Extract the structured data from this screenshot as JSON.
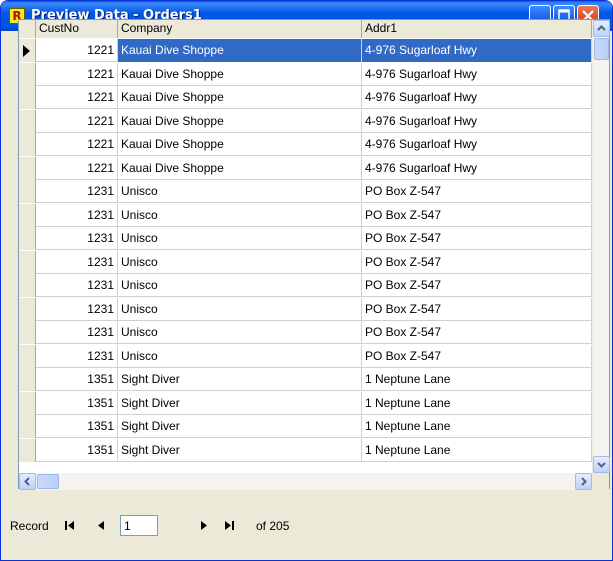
{
  "window": {
    "title": "Preview Data - Orders1",
    "app_icon_letter": "R",
    "accent": "#0055E5",
    "selection_color": "#316AC5"
  },
  "grid": {
    "columns": [
      "CustNo",
      "Company",
      "Addr1"
    ],
    "rows": [
      {
        "custno": "1221",
        "company": "Kauai Dive Shoppe",
        "addr1": "4-976 Sugarloaf Hwy",
        "selected": true
      },
      {
        "custno": "1221",
        "company": "Kauai Dive Shoppe",
        "addr1": "4-976 Sugarloaf Hwy"
      },
      {
        "custno": "1221",
        "company": "Kauai Dive Shoppe",
        "addr1": "4-976 Sugarloaf Hwy"
      },
      {
        "custno": "1221",
        "company": "Kauai Dive Shoppe",
        "addr1": "4-976 Sugarloaf Hwy"
      },
      {
        "custno": "1221",
        "company": "Kauai Dive Shoppe",
        "addr1": "4-976 Sugarloaf Hwy"
      },
      {
        "custno": "1221",
        "company": "Kauai Dive Shoppe",
        "addr1": "4-976 Sugarloaf Hwy"
      },
      {
        "custno": "1231",
        "company": "Unisco",
        "addr1": "PO Box Z-547"
      },
      {
        "custno": "1231",
        "company": "Unisco",
        "addr1": "PO Box Z-547"
      },
      {
        "custno": "1231",
        "company": "Unisco",
        "addr1": "PO Box Z-547"
      },
      {
        "custno": "1231",
        "company": "Unisco",
        "addr1": "PO Box Z-547"
      },
      {
        "custno": "1231",
        "company": "Unisco",
        "addr1": "PO Box Z-547"
      },
      {
        "custno": "1231",
        "company": "Unisco",
        "addr1": "PO Box Z-547"
      },
      {
        "custno": "1231",
        "company": "Unisco",
        "addr1": "PO Box Z-547"
      },
      {
        "custno": "1231",
        "company": "Unisco",
        "addr1": "PO Box Z-547"
      },
      {
        "custno": "1351",
        "company": "Sight Diver",
        "addr1": "1 Neptune Lane"
      },
      {
        "custno": "1351",
        "company": "Sight Diver",
        "addr1": "1 Neptune Lane"
      },
      {
        "custno": "1351",
        "company": "Sight Diver",
        "addr1": "1 Neptune Lane"
      },
      {
        "custno": "1351",
        "company": "Sight Diver",
        "addr1": "1 Neptune Lane"
      }
    ]
  },
  "navigator": {
    "label": "Record",
    "current_record": "1",
    "of_text": "of 205",
    "icons": [
      "first-record-icon",
      "prior-record-icon",
      "next-record-icon",
      "last-record-icon"
    ]
  }
}
